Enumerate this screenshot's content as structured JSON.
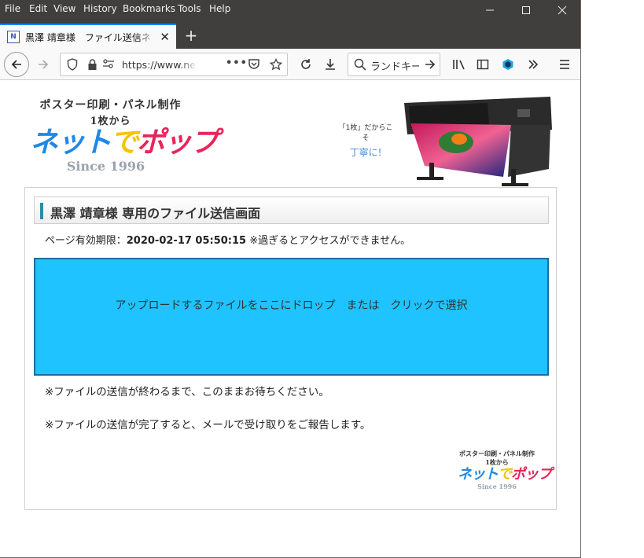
{
  "menu": {
    "file": "File",
    "edit": "Edit",
    "view": "View",
    "history": "History",
    "bookmarks": "Bookmarks",
    "tools": "Tools",
    "help": "Help"
  },
  "tab": {
    "favicon_text": "N",
    "title": "黒澤 靖章様　ファイル送信ネ",
    "close": "✕",
    "new_tab": "+"
  },
  "navbar": {
    "url": "https://www.net",
    "search": "ランドキー"
  },
  "page": {
    "logo": {
      "sub": "ポスター印刷・パネル制作",
      "sub2": "1枚から",
      "main_a": "ネット",
      "main_b": "で",
      "main_c": "ポップ",
      "since": "Since 1996"
    },
    "tagline": {
      "line1": "「1枚」だからこそ",
      "line2": "丁寧に!"
    },
    "heading": "黒澤 靖章様 専用のファイル送信画面",
    "expiry_label": "ページ有効期限：",
    "expiry_value": "2020-02-17 05:50:15",
    "expiry_note": " ※過ぎるとアクセスができません。",
    "dropzone_text": "アップロードするファイルをここにドロップ　または　クリックで選択",
    "note1": "※ファイルの送信が終わるまで、このままお待ちください。",
    "note2": "※ファイルの送信が完了すると、メールで受け取りをご報告します。"
  },
  "colors": {
    "titlebar": "#403f3d",
    "tab_accent": "#0a84ff",
    "dropzone": "#1ec3ff",
    "logo_blue": "#1e88e5",
    "logo_red": "#e8255a",
    "logo_yellow": "#f5c400"
  }
}
